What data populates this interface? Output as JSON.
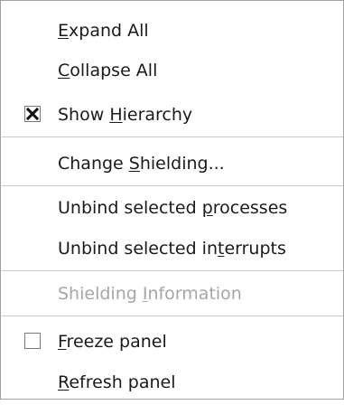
{
  "menu": {
    "items": [
      {
        "name": "expand-all",
        "label": "Expand All",
        "mnemonic_index": 0,
        "enabled": true,
        "checkbox": null
      },
      {
        "name": "collapse-all",
        "label": "Collapse All",
        "mnemonic_index": 0,
        "enabled": true,
        "checkbox": null
      },
      {
        "name": "show-hierarchy",
        "label": "Show Hierarchy",
        "mnemonic_index": 5,
        "enabled": true,
        "checkbox": true
      },
      {
        "name": "change-shielding",
        "label": "Change Shielding...",
        "mnemonic_index": 7,
        "enabled": true,
        "checkbox": null
      },
      {
        "name": "unbind-selected-processes",
        "label": "Unbind selected processes",
        "mnemonic_index": 16,
        "enabled": true,
        "checkbox": null
      },
      {
        "name": "unbind-selected-interrupts",
        "label": "Unbind selected interrupts",
        "mnemonic_index": 18,
        "enabled": true,
        "checkbox": null
      },
      {
        "name": "shielding-information",
        "label": "Shielding Information",
        "mnemonic_index": 10,
        "enabled": false,
        "checkbox": null
      },
      {
        "name": "freeze-panel",
        "label": "Freeze panel",
        "mnemonic_index": 0,
        "enabled": true,
        "checkbox": false
      },
      {
        "name": "refresh-panel",
        "label": "Refresh panel",
        "mnemonic_index": 0,
        "enabled": true,
        "checkbox": null
      }
    ],
    "colors": {
      "text": "#1a1a1a",
      "disabled_text": "#a6a6a6",
      "separator": "#c8c8c8",
      "border": "#a0a0a0"
    }
  }
}
